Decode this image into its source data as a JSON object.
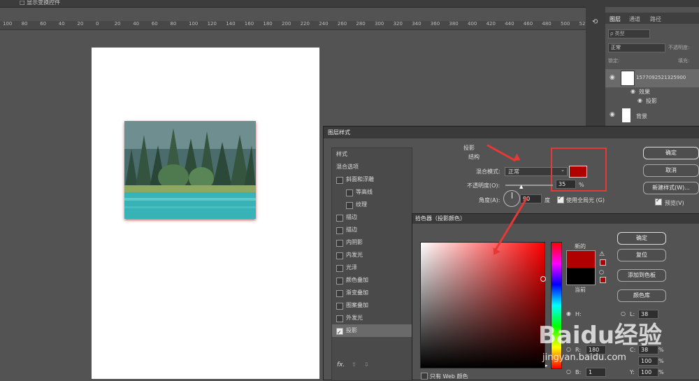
{
  "menubar": {
    "text": "□ 显示变换控件"
  },
  "ruler": {
    "ticks": [
      "100",
      "80",
      "60",
      "40",
      "20",
      "0",
      "20",
      "40",
      "60",
      "80",
      "100",
      "120",
      "140",
      "160",
      "180",
      "200",
      "220",
      "240",
      "260",
      "280",
      "300",
      "320",
      "340",
      "360",
      "380",
      "400",
      "420",
      "440",
      "460",
      "480",
      "500",
      "52"
    ]
  },
  "layers_panel": {
    "tabs": [
      "图层",
      "通道",
      "路径"
    ],
    "search_placeholder": "ρ 类型",
    "blend_mode": "正常",
    "opacity_label": "不透明度:",
    "lock_label": "锁定:",
    "fill_label": "填充:",
    "layers": [
      {
        "name": "1577092521325900"
      },
      {
        "name": "效果"
      },
      {
        "name": "投影"
      },
      {
        "name": "背景"
      }
    ]
  },
  "layer_style_dialog": {
    "title": "图层样式",
    "style_list": [
      {
        "label": "样式",
        "checkbox": false,
        "checked": false
      },
      {
        "label": "混合选项",
        "checkbox": false,
        "checked": false
      },
      {
        "label": "斜面和浮雕",
        "checkbox": true,
        "checked": false
      },
      {
        "label": "等高线",
        "checkbox": true,
        "checked": false
      },
      {
        "label": "纹理",
        "checkbox": true,
        "checked": false
      },
      {
        "label": "描边",
        "checkbox": true,
        "checked": false
      },
      {
        "label": "描边",
        "checkbox": true,
        "checked": false
      },
      {
        "label": "内阴影",
        "checkbox": true,
        "checked": false
      },
      {
        "label": "内发光",
        "checkbox": true,
        "checked": false
      },
      {
        "label": "光泽",
        "checkbox": true,
        "checked": false
      },
      {
        "label": "颜色叠加",
        "checkbox": true,
        "checked": false
      },
      {
        "label": "渐变叠加",
        "checkbox": true,
        "checked": false
      },
      {
        "label": "图案叠加",
        "checkbox": true,
        "checked": false
      },
      {
        "label": "外发光",
        "checkbox": true,
        "checked": false
      },
      {
        "label": "投影",
        "checkbox": true,
        "checked": true
      }
    ],
    "fx_label": "fx.",
    "section_title": "投影",
    "structure_label": "结构",
    "blend_mode_label": "混合模式:",
    "blend_mode_value": "正常",
    "shadow_color": "#b00000",
    "opacity_label": "不透明度(O):",
    "opacity_value": "35",
    "opacity_unit": "%",
    "angle_label": "角度(A):",
    "angle_value": "90",
    "angle_unit": "度",
    "global_light_label": "使用全局光 (G)",
    "global_light_checked": true,
    "buttons": {
      "ok": "确定",
      "cancel": "取消",
      "new_style": "新建样式(W)...",
      "preview": "预览(V)"
    },
    "preview_checked": true
  },
  "color_picker": {
    "title": "拾色器（投影颜色）",
    "new_label": "新的",
    "current_label": "当前",
    "new_color": "#b00000",
    "current_color": "#000000",
    "buttons": {
      "ok": "确定",
      "reset": "复位",
      "add_swatch": "添加到色板",
      "libraries": "颜色库"
    },
    "fields": {
      "H_label": "H:",
      "L_label": "L:",
      "L_value": "38",
      "R_label": "R:",
      "R_value": "180",
      "B_label": "B:",
      "B_value": "1",
      "C_label": "C:",
      "C_value": "38",
      "M_pct": "100",
      "Y_label": "Y:",
      "Y_value": "100",
      "pct": "%"
    },
    "web_only_label": "只有 Web 颜色"
  },
  "watermark": {
    "brand": "Baidu经验",
    "url": "jingyan.baidu.com"
  },
  "colors": {
    "accent_red": "#e53935",
    "shadow_red": "#b00000"
  }
}
